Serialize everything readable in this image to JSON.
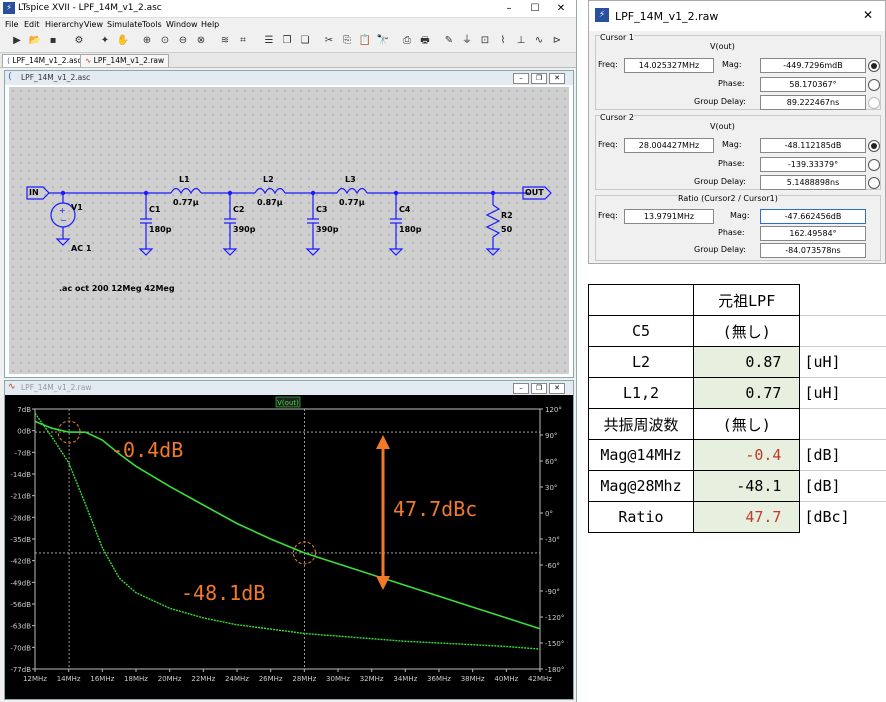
{
  "app": {
    "title": "LTspice XVII - LPF_14M_v1_2.asc"
  },
  "menu": [
    "File",
    "Edit",
    "Hierarchy",
    "View",
    "Simulate",
    "Tools",
    "Window",
    "Help"
  ],
  "tabs": [
    "LPF_14M_v1_2.asc",
    "LPF_14M_v1_2.raw"
  ],
  "schematic": {
    "title": "LPF_14M_v1_2.asc",
    "in_label": "IN",
    "out_label": "OUT",
    "source": {
      "name": "V1",
      "value": "AC 1"
    },
    "inductors": [
      {
        "name": "L1",
        "value": "0.77μ"
      },
      {
        "name": "L2",
        "value": "0.87μ"
      },
      {
        "name": "L3",
        "value": "0.77μ"
      }
    ],
    "capacitors": [
      {
        "name": "C1",
        "value": "180p"
      },
      {
        "name": "C2",
        "value": "390p"
      },
      {
        "name": "C3",
        "value": "390p"
      },
      {
        "name": "C4",
        "value": "180p"
      }
    ],
    "resistor": {
      "name": "R2",
      "value": "50"
    },
    "directive": ".ac oct 200 12Meg 42Meg"
  },
  "waveform": {
    "title": "LPF_14M_v1_2.raw",
    "trace_label": "V(out)",
    "annotations": {
      "peak": "-0.4dB",
      "at28": "-48.1dB",
      "ratio": "47.7dBc"
    }
  },
  "chart_data": {
    "type": "line",
    "xlabel": "",
    "ylabel": "",
    "xlim": [
      12,
      42
    ],
    "ylim": [
      -77,
      7
    ],
    "y2lim": [
      -180,
      120
    ],
    "x_ticks": [
      "12MHz",
      "14MHz",
      "16MHz",
      "18MHz",
      "20MHz",
      "22MHz",
      "24MHz",
      "26MHz",
      "28MHz",
      "30MHz",
      "32MHz",
      "34MHz",
      "36MHz",
      "38MHz",
      "40MHz",
      "42MHz"
    ],
    "y_ticks": [
      "7dB",
      "0dB",
      "-7dB",
      "-14dB",
      "-21dB",
      "-28dB",
      "-35dB",
      "-42dB",
      "-49dB",
      "-56dB",
      "-63dB",
      "-70dB",
      "-77dB"
    ],
    "y2_ticks": [
      "120°",
      "90°",
      "60°",
      "30°",
      "0°",
      "-30°",
      "-60°",
      "-90°",
      "-120°",
      "-150°",
      "-180°"
    ],
    "series": [
      {
        "name": "magnitude",
        "x": [
          12,
          13,
          14,
          15,
          16,
          17,
          18,
          20,
          22,
          24,
          26,
          28,
          30,
          32,
          34,
          36,
          38,
          40,
          42
        ],
        "y": [
          3,
          0.8,
          -0.45,
          -0.5,
          -3,
          -7.5,
          -11.5,
          -18,
          -24,
          -30,
          -35,
          -39.5,
          -43,
          -46.5,
          -50,
          -53.5,
          -57,
          -60.5,
          -64
        ]
      },
      {
        "name": "phase",
        "x": [
          12,
          13,
          14,
          15,
          16,
          17,
          18,
          20,
          22,
          24,
          26,
          28,
          30,
          32,
          34,
          36,
          38,
          40,
          42
        ],
        "y": [
          115,
          88,
          58,
          10,
          -40,
          -75,
          -92,
          -110,
          -121,
          -129,
          -134,
          -139,
          -142,
          -145,
          -148,
          -150,
          -152,
          -154,
          -157
        ]
      }
    ],
    "cursors": {
      "x": [
        14.025,
        28.004
      ]
    },
    "colors": {
      "trace": "#3bdc3b",
      "grid": "#555555",
      "annotation": "#f07a2a"
    }
  },
  "cursor_window": {
    "title": "LPF_14M_v1_2.raw",
    "cursor1": {
      "header": "Cursor 1",
      "signal": "V(out)",
      "freq_label": "Freq:",
      "freq": "14.025327MHz",
      "mag_label": "Mag:",
      "mag": "-449.7296mdB",
      "phase_label": "Phase:",
      "phase": "58.170367°",
      "gd_label": "Group Delay:",
      "gd": "89.222467ns"
    },
    "cursor2": {
      "header": "Cursor 2",
      "signal": "V(out)",
      "freq_label": "Freq:",
      "freq": "28.004427MHz",
      "mag_label": "Mag:",
      "mag": "-48.112185dB",
      "phase_label": "Phase:",
      "phase": "-139.33379°",
      "gd_label": "Group Delay:",
      "gd": "5.1488898ns"
    },
    "ratio": {
      "header": "Ratio (Cursor2 / Cursor1)",
      "freq_label": "Freq:",
      "freq": "13.9791MHz",
      "mag_label": "Mag:",
      "mag": "-47.662456dB",
      "phase_label": "Phase:",
      "phase": "162.49584°",
      "gd_label": "Group Delay:",
      "gd": "-84.073578ns"
    }
  },
  "table": {
    "header": [
      "",
      "元祖LPF",
      ""
    ],
    "rows": [
      {
        "label": "C5",
        "value": "(無し)",
        "unit": ""
      },
      {
        "label": "L2",
        "value": "0.87",
        "unit": "[uH]"
      },
      {
        "label": "L1,2",
        "value": "0.77",
        "unit": "[uH]"
      },
      {
        "label": "共振周波数",
        "value": "(無し)",
        "unit": ""
      },
      {
        "label": "Mag@14MHz",
        "value": "-0.4",
        "unit": "[dB]"
      },
      {
        "label": "Mag@28Mhz",
        "value": "-48.1",
        "unit": "[dB]"
      },
      {
        "label": "Ratio",
        "value": "47.7",
        "unit": "[dBc]"
      }
    ]
  }
}
